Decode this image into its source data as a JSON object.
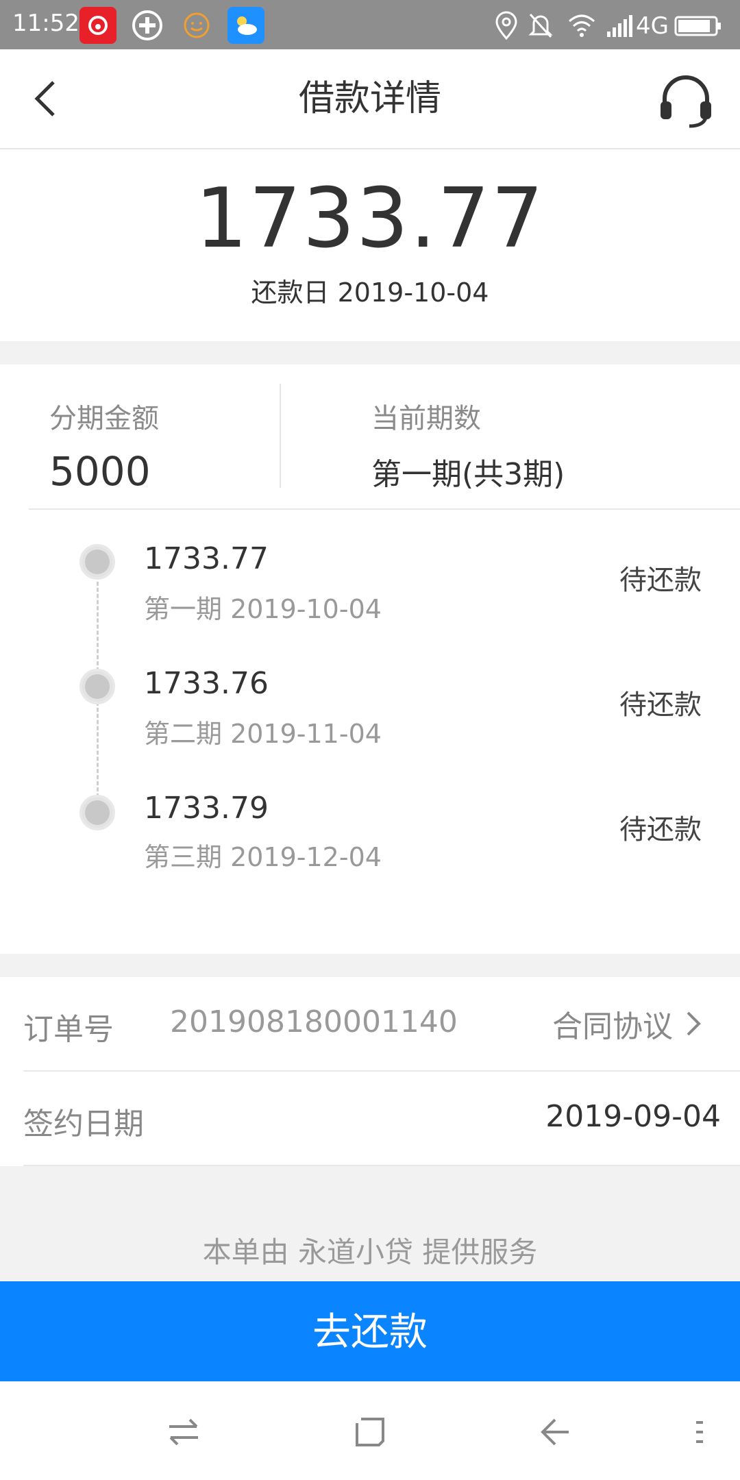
{
  "status_bar": {
    "time": "11:52",
    "network": "4G"
  },
  "nav": {
    "title": "借款详情"
  },
  "summary": {
    "amount": "1733.77",
    "repay_date": "还款日 2019-10-04"
  },
  "plan": {
    "amount_label": "分期金额",
    "amount_value": "5000",
    "period_label": "当前期数",
    "period_value": "第一期(共3期)"
  },
  "installments": [
    {
      "amount": "1733.77",
      "sub": "第一期 2019-10-04",
      "status": "待还款"
    },
    {
      "amount": "1733.76",
      "sub": "第二期 2019-11-04",
      "status": "待还款"
    },
    {
      "amount": "1733.79",
      "sub": "第三期 2019-12-04",
      "status": "待还款"
    }
  ],
  "order": {
    "order_label": "订单号",
    "order_no": "201908180001140",
    "contract_link": "合同协议",
    "sign_label": "签约日期",
    "sign_date": "2019-09-04"
  },
  "provider_note": "本单由 永道小贷 提供服务",
  "repay_button": "去还款",
  "colors": {
    "primary": "#0a84ff",
    "status_bar": "#8e8e8e"
  }
}
